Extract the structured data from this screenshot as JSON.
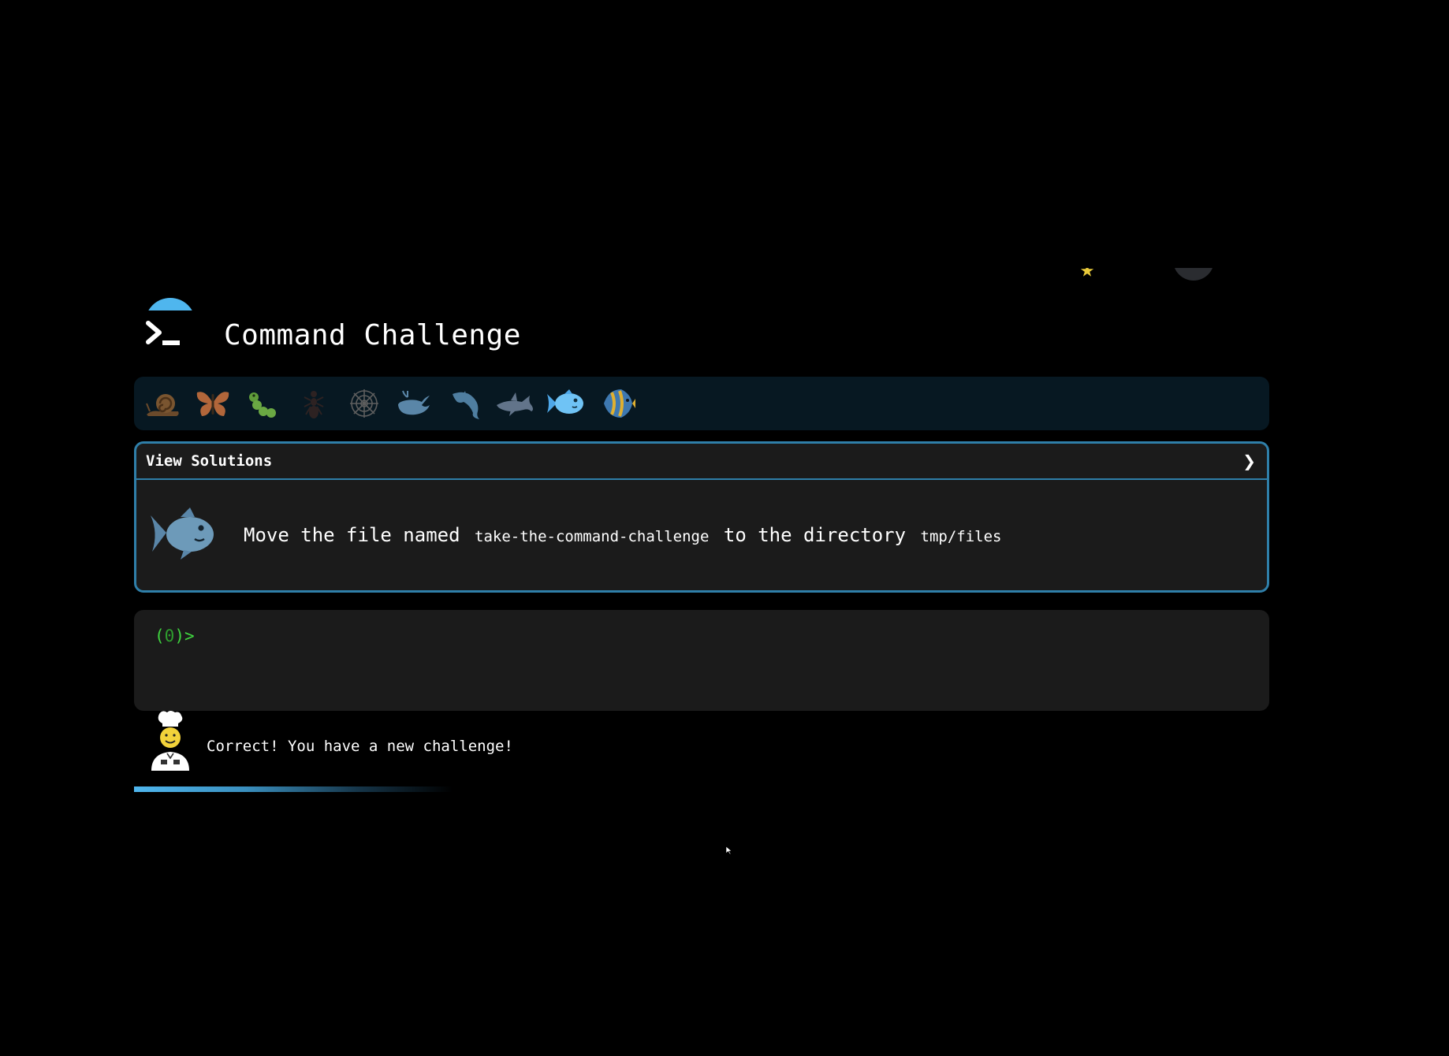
{
  "app": {
    "title": "Command Challenge"
  },
  "levels": [
    {
      "name": "snail",
      "icon": "snail-icon"
    },
    {
      "name": "butterfly",
      "icon": "butterfly-icon"
    },
    {
      "name": "caterpillar",
      "icon": "caterpillar-icon"
    },
    {
      "name": "ant",
      "icon": "ant-icon"
    },
    {
      "name": "spider-web",
      "icon": "spider-web-icon"
    },
    {
      "name": "whale",
      "icon": "whale-icon"
    },
    {
      "name": "dolphin",
      "icon": "dolphin-icon"
    },
    {
      "name": "shark",
      "icon": "shark-icon"
    },
    {
      "name": "fish",
      "icon": "fish-icon"
    },
    {
      "name": "tropical-fish",
      "icon": "tropical-fish-icon"
    }
  ],
  "solutions": {
    "label": "View Solutions",
    "chevron": "❯"
  },
  "challenge": {
    "icon": "fish-icon",
    "text_1": "Move the file named",
    "code_1": "take-the-command-challenge",
    "text_2": "to the directory",
    "code_2": "tmp/files"
  },
  "terminal": {
    "prompt_open": "(",
    "prompt_count": "0",
    "prompt_close": ")>",
    "input_value": ""
  },
  "feedback": {
    "icon": "chef-icon",
    "message": "Correct! You have a new challenge!"
  },
  "progress": {
    "fraction": 0.47
  },
  "colors": {
    "accent": "#4fb6ee",
    "card_border": "#2f7fa9",
    "prompt_green": "#3fd43f",
    "level_bar_bg": "#071822",
    "panel_bg": "#1b1b1b"
  }
}
